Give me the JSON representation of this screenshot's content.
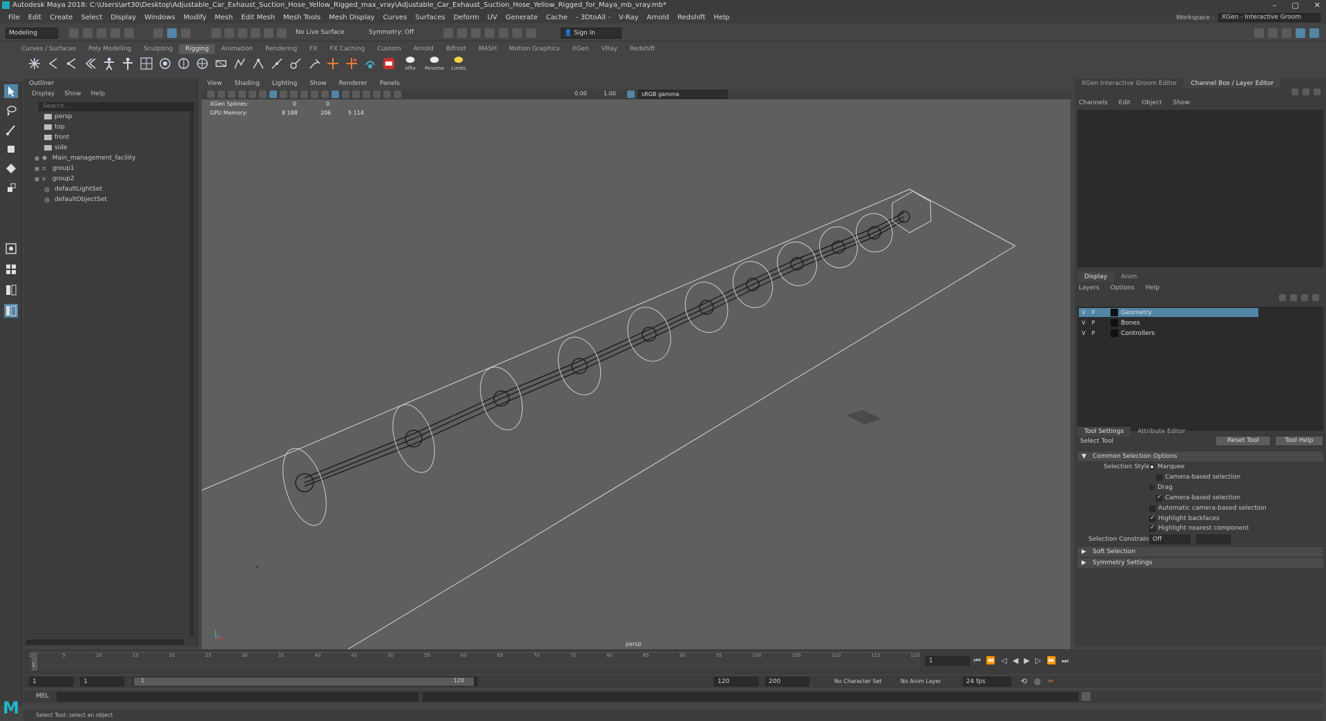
{
  "window": {
    "title": "Autodesk Maya 2018: C:\\Users\\art30\\Desktop\\Adjustable_Car_Exhaust_Suction_Hose_Yellow_Rigged_max_vray\\Adjustable_Car_Exhaust_Suction_Hose_Yellow_Rigged_for_Maya_mb_vray.mb*",
    "controls": [
      "–",
      "▢",
      "✕"
    ]
  },
  "menubar": {
    "items": [
      "File",
      "Edit",
      "Create",
      "Select",
      "Display",
      "Windows",
      "Modify",
      "Mesh",
      "Edit Mesh",
      "Mesh Tools",
      "Mesh Display",
      "Curves",
      "Surfaces",
      "Deform",
      "UV",
      "Generate",
      "Cache",
      "- 3DtoAll -",
      "V-Ray",
      "Arnold",
      "Redshift",
      "Help"
    ],
    "workspace_label": "Workspace :",
    "workspace_value": "XGen - Interactive Groom"
  },
  "statusline": {
    "mode": "Modeling",
    "live_surface": "No Live Surface",
    "symmetry": "Symmetry: Off",
    "sign_in": "Sign In"
  },
  "shelf": {
    "tabs": [
      "Curves / Surfaces",
      "Poly Modeling",
      "Sculpting",
      "Rigging",
      "Animation",
      "Rendering",
      "FX",
      "FX Caching",
      "Custom",
      "Arnold",
      "Bifrost",
      "MASH",
      "Motion Graphics",
      "XGen",
      "VRay",
      "Redshift"
    ],
    "active_tab": "Rigging",
    "labeled_icons": [
      "Affix",
      "Reverse",
      "Limits"
    ]
  },
  "outliner": {
    "title": "Outliner",
    "menu": [
      "Display",
      "Show",
      "Help"
    ],
    "search_placeholder": "Search...",
    "items": [
      {
        "label": "persp",
        "type": "camera",
        "expandable": false
      },
      {
        "label": "top",
        "type": "camera",
        "expandable": false
      },
      {
        "label": "front",
        "type": "camera",
        "expandable": false
      },
      {
        "label": "side",
        "type": "camera",
        "expandable": false
      },
      {
        "label": "Main_management_facility",
        "type": "transform",
        "expandable": true
      },
      {
        "label": "group1",
        "type": "group",
        "expandable": true
      },
      {
        "label": "group2",
        "type": "group",
        "expandable": true
      },
      {
        "label": "defaultLightSet",
        "type": "set",
        "expandable": false
      },
      {
        "label": "defaultObjectSet",
        "type": "set",
        "expandable": false
      }
    ]
  },
  "viewport": {
    "menu": [
      "View",
      "Shading",
      "Lighting",
      "Show",
      "Renderer",
      "Panels"
    ],
    "num_field_1": "0.00",
    "num_field_2": "1.00",
    "color_space": "sRGB gamma",
    "hud": {
      "xgen_label": "XGen Splines:",
      "xgen_v1": "0",
      "xgen_v2": "0",
      "gpu_label": "GPU Memory:",
      "gpu_v1": "8 188",
      "gpu_v2": "206",
      "gpu_v3": "5 114"
    },
    "camera_label": "persp"
  },
  "right_panel": {
    "top_tabs": [
      "XGen Interactive Groom Editor",
      "Channel Box / Layer Editor"
    ],
    "active_top_tab": "Channel Box / Layer Editor",
    "channel_menu": [
      "Channels",
      "Edit",
      "Object",
      "Show"
    ],
    "layer_tabs": [
      "Display",
      "Anim"
    ],
    "layer_menu": [
      "Layers",
      "Options",
      "Help"
    ],
    "layers": [
      {
        "v": "V",
        "p": "P",
        "name": "Geometry",
        "selected": true
      },
      {
        "v": "V",
        "p": "P",
        "name": "Bones",
        "selected": false
      },
      {
        "v": "V",
        "p": "P",
        "name": "Controllers",
        "selected": false
      }
    ],
    "tool_tabs": [
      "Tool Settings",
      "Attribute Editor"
    ],
    "tool_name": "Select Tool",
    "reset_tool": "Reset Tool",
    "tool_help": "Tool Help",
    "common_section": "Common Selection Options",
    "selection_style_label": "Selection Style:",
    "marquee": "Marquee",
    "camera_based_1": "Camera-based selection",
    "drag": "Drag",
    "camera_based_2": "Camera-based selection",
    "auto_camera": "Automatic camera-based selection",
    "highlight_backfaces": "Highlight backfaces",
    "highlight_nearest": "Highlight nearest component",
    "constraint_label": "Selection Constraint:",
    "constraint_value": "Off",
    "soft_selection": "Soft Selection",
    "symmetry_settings": "Symmetry Settings"
  },
  "timeline": {
    "ticks": [
      "1",
      "5",
      "10",
      "15",
      "20",
      "25",
      "30",
      "35",
      "40",
      "45",
      "50",
      "55",
      "60",
      "65",
      "70",
      "75",
      "80",
      "85",
      "90",
      "95",
      "100",
      "105",
      "110",
      "115",
      "120"
    ],
    "current_frame": "1"
  },
  "range": {
    "start": "1",
    "start2": "1",
    "slider_start": "1",
    "slider_end": "120",
    "end": "120",
    "end2": "200",
    "character_set": "No Character Set",
    "anim_layer": "No Anim Layer",
    "fps": "24 fps"
  },
  "cmdline": {
    "label": "MEL"
  },
  "helpline": {
    "text": "Select Tool: select an object"
  },
  "colors": {
    "accent": "#5285a6",
    "viewport_bg": "#5f5f5f",
    "panel_bg": "#3c3c3c",
    "maya_teal": "#23b6c9"
  }
}
